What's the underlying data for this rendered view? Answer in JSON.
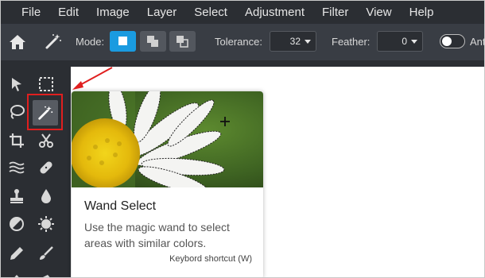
{
  "menu": {
    "items": [
      "File",
      "Edit",
      "Image",
      "Layer",
      "Select",
      "Adjustment",
      "Filter",
      "View",
      "Help"
    ]
  },
  "options": {
    "mode_label": "Mode:",
    "tolerance_label": "Tolerance:",
    "tolerance_value": "32",
    "feather_label": "Feather:",
    "feather_value": "0",
    "antialias_label": "Ant"
  },
  "tools": {
    "icons": [
      "pointer-icon",
      "marquee-select-icon",
      "lasso-icon",
      "magic-wand-icon",
      "crop-icon",
      "scissors-icon",
      "liquify-icon",
      "healing-bandage-icon",
      "clone-stamp-icon",
      "blur-drop-icon",
      "dodge-burn-icon",
      "sponge-icon",
      "pencil-icon",
      "brush-icon"
    ],
    "selected": "magic-wand-icon"
  },
  "tooltip": {
    "title": "Wand Select",
    "description": "Use the magic wand to select areas with similar colors.",
    "shortcut": "Keybord shortcut (W)"
  },
  "colors": {
    "accent": "#1a9be0",
    "annotation_red": "#e01f1f",
    "menu_bg": "#2b2e33",
    "options_bg": "#393d44"
  }
}
